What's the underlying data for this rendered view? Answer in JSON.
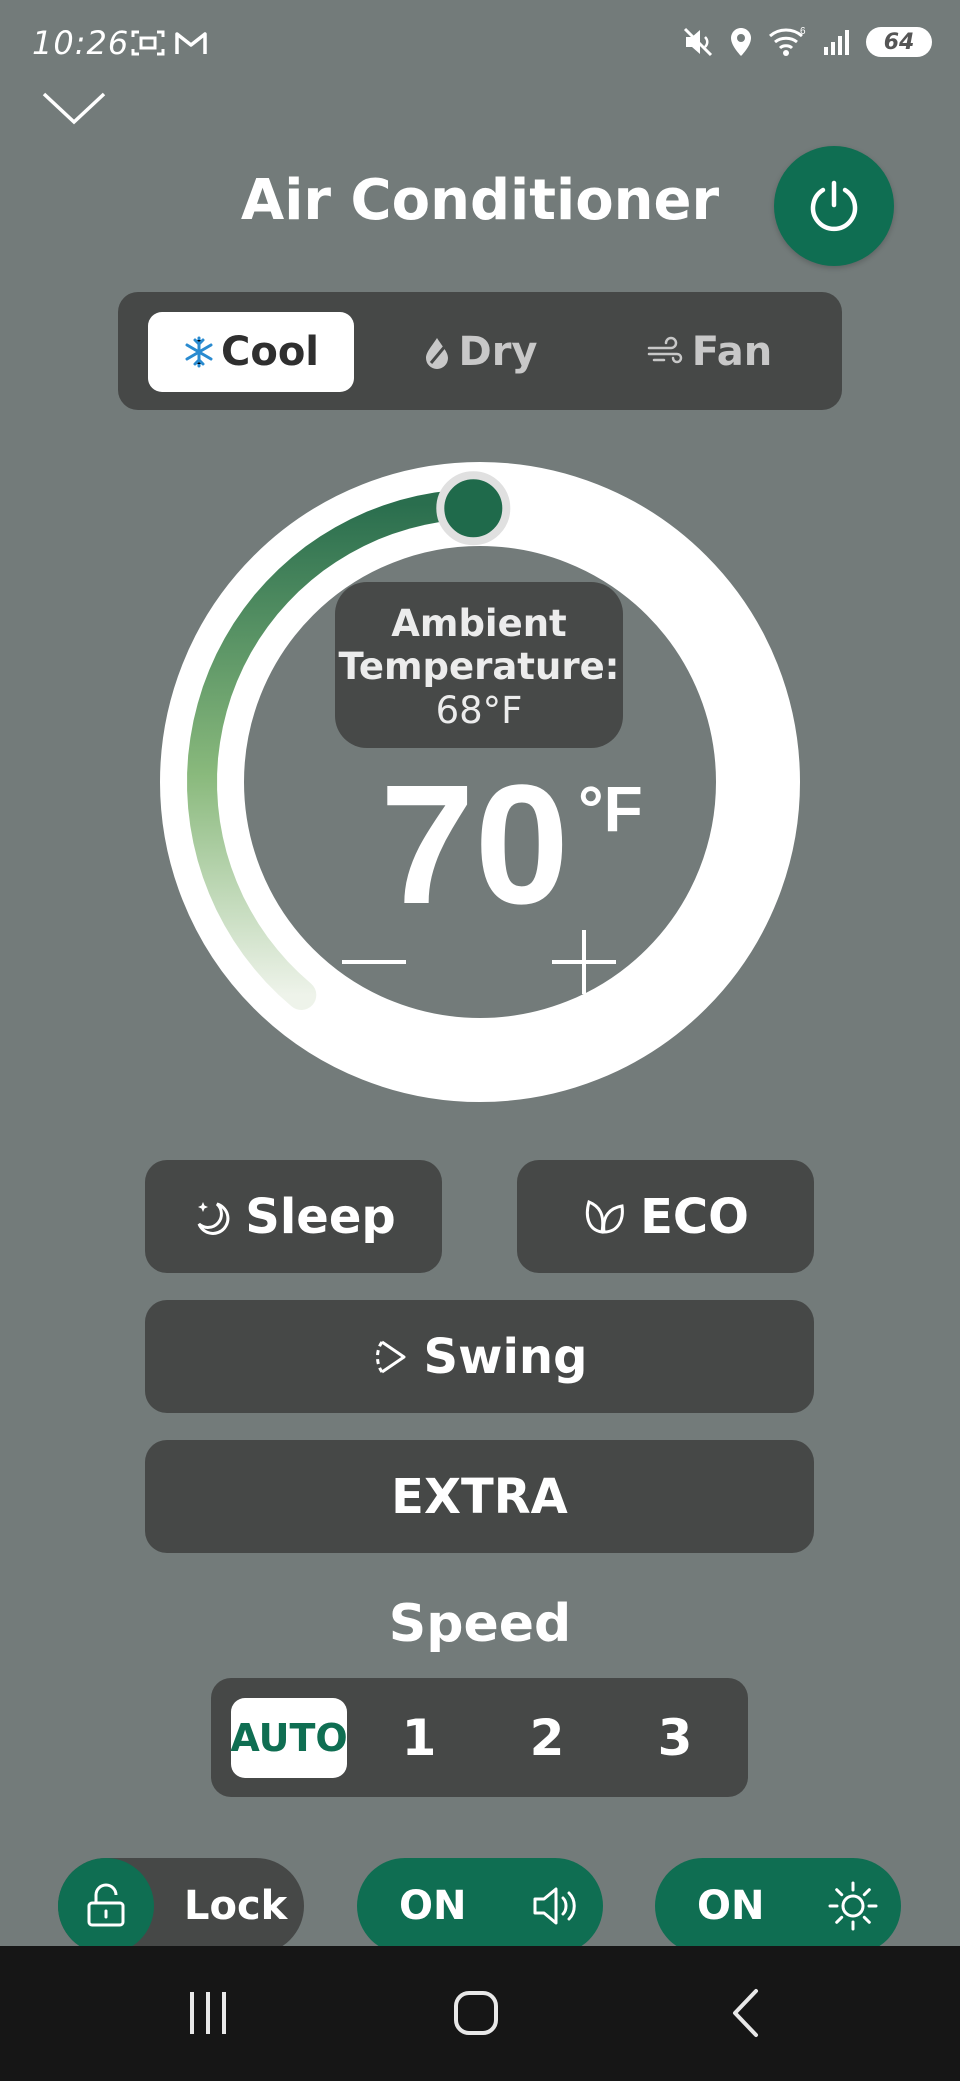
{
  "status_bar": {
    "time": "10:26",
    "battery": "64",
    "icons": [
      "screenshot-icon",
      "gmail-icon",
      "mute-icon",
      "location-icon",
      "wifi-icon",
      "signal-icon",
      "battery-icon"
    ]
  },
  "header": {
    "title": "Air Conditioner",
    "back_icon": "chevron-down-icon",
    "power_icon": "power-icon"
  },
  "modes": [
    {
      "label": "Cool",
      "icon": "snowflake-icon",
      "active": true
    },
    {
      "label": "Dry",
      "icon": "droplet-icon",
      "active": false
    },
    {
      "label": "Fan",
      "icon": "wind-icon",
      "active": false
    }
  ],
  "thermostat": {
    "ambient_label": "Ambient Temperature:",
    "ambient_value": "68°F",
    "setpoint": "70",
    "unit": "°F",
    "minus_label": "−",
    "plus_label": "+"
  },
  "options": {
    "sleep": "Sleep",
    "eco": "ECO",
    "swing": "Swing",
    "extra": "EXTRA"
  },
  "speed": {
    "label": "Speed",
    "options": [
      "AUTO",
      "1",
      "2",
      "3"
    ],
    "selected": "AUTO"
  },
  "toggles": {
    "lock_label": "Lock",
    "sound_label": "ON",
    "light_label": "ON"
  },
  "colors": {
    "background": "#737b7a",
    "panel": "#464847",
    "accent": "#0f6e52",
    "dial_track": "#ffffff"
  },
  "nav": [
    "recent-apps-icon",
    "home-icon",
    "back-icon"
  ]
}
